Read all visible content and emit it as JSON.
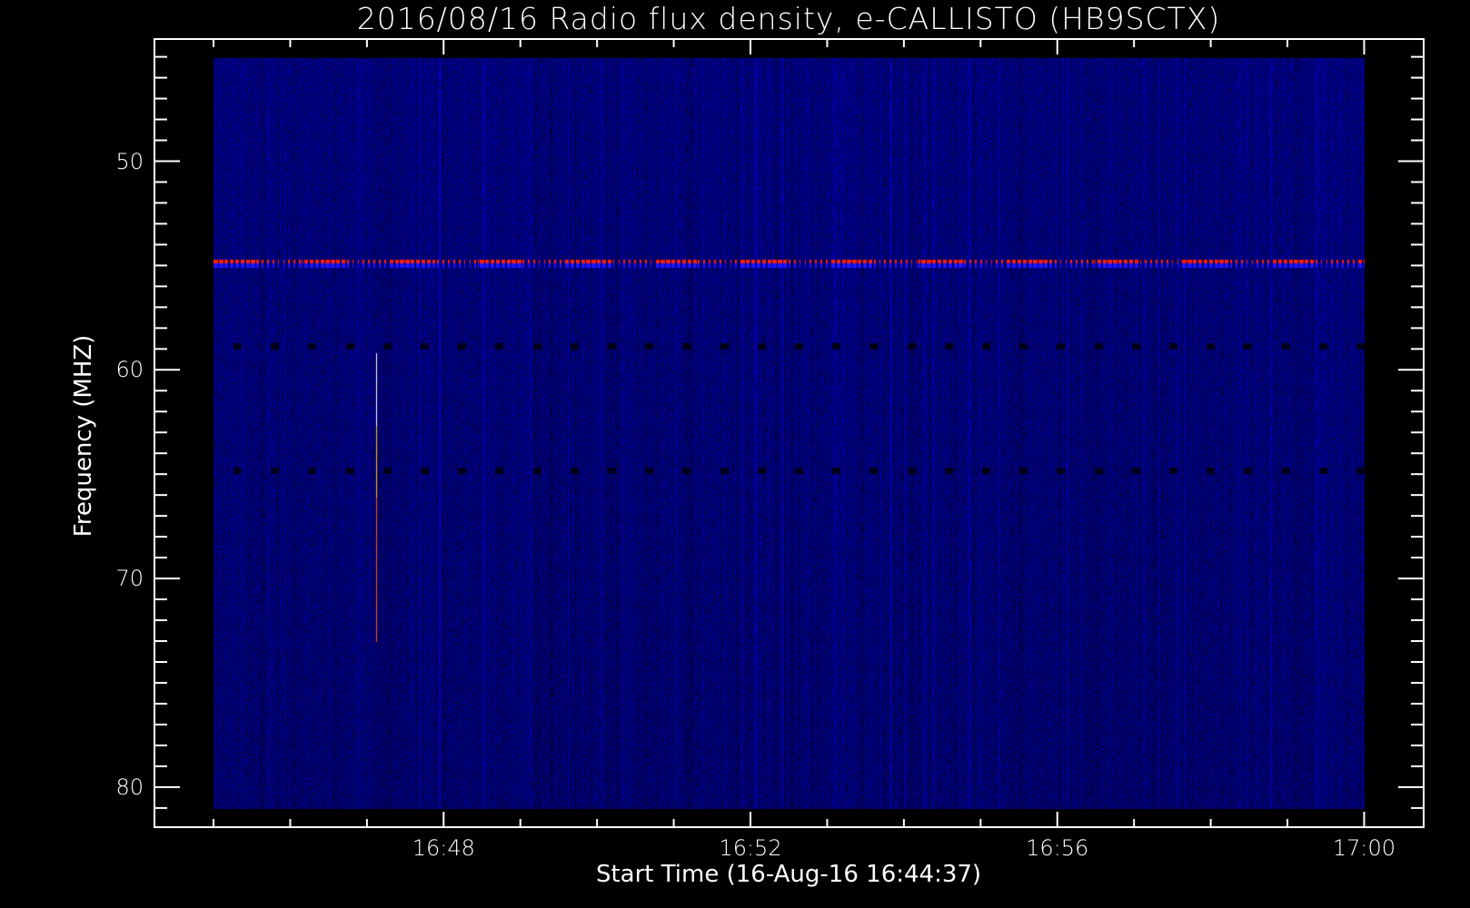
{
  "chart_data": {
    "type": "heatmap",
    "title": "2016/08/16  Radio flux density, e-CALLISTO (HB9SCTX)",
    "xlabel": "Start Time (16-Aug-16 16:44:37)",
    "ylabel": "Frequency (MHZ)",
    "x_tick_labels": [
      "16:48",
      "16:52",
      "16:56",
      "17:00"
    ],
    "x_tick_minutes": [
      48,
      52,
      56,
      60
    ],
    "x_range_minutes_after_16h": [
      45,
      60
    ],
    "y_tick_labels": [
      "50",
      "60",
      "70",
      "80"
    ],
    "y_ticks": [
      50,
      60,
      70,
      80
    ],
    "ylim": [
      45,
      81
    ],
    "axis_range_frame": {
      "y": [
        44.15,
        81.9
      ],
      "x_minutes": [
        44.5,
        64.6
      ]
    },
    "y_inverted": true,
    "colormap": "blue-red-yellow-white",
    "background_color": "#0000a8",
    "features": [
      {
        "kind": "narrowband-interference",
        "freq_mhz": 54.8,
        "color": "#ff2000"
      },
      {
        "kind": "dropouts",
        "freq_mhz": 58.85,
        "color": "#000010"
      },
      {
        "kind": "dropouts",
        "freq_mhz": 64.8,
        "color": "#000010"
      },
      {
        "kind": "spike",
        "time": "16:47:07",
        "freq_range_mhz": [
          59.2,
          73
        ],
        "color": "#ffffff"
      }
    ]
  }
}
